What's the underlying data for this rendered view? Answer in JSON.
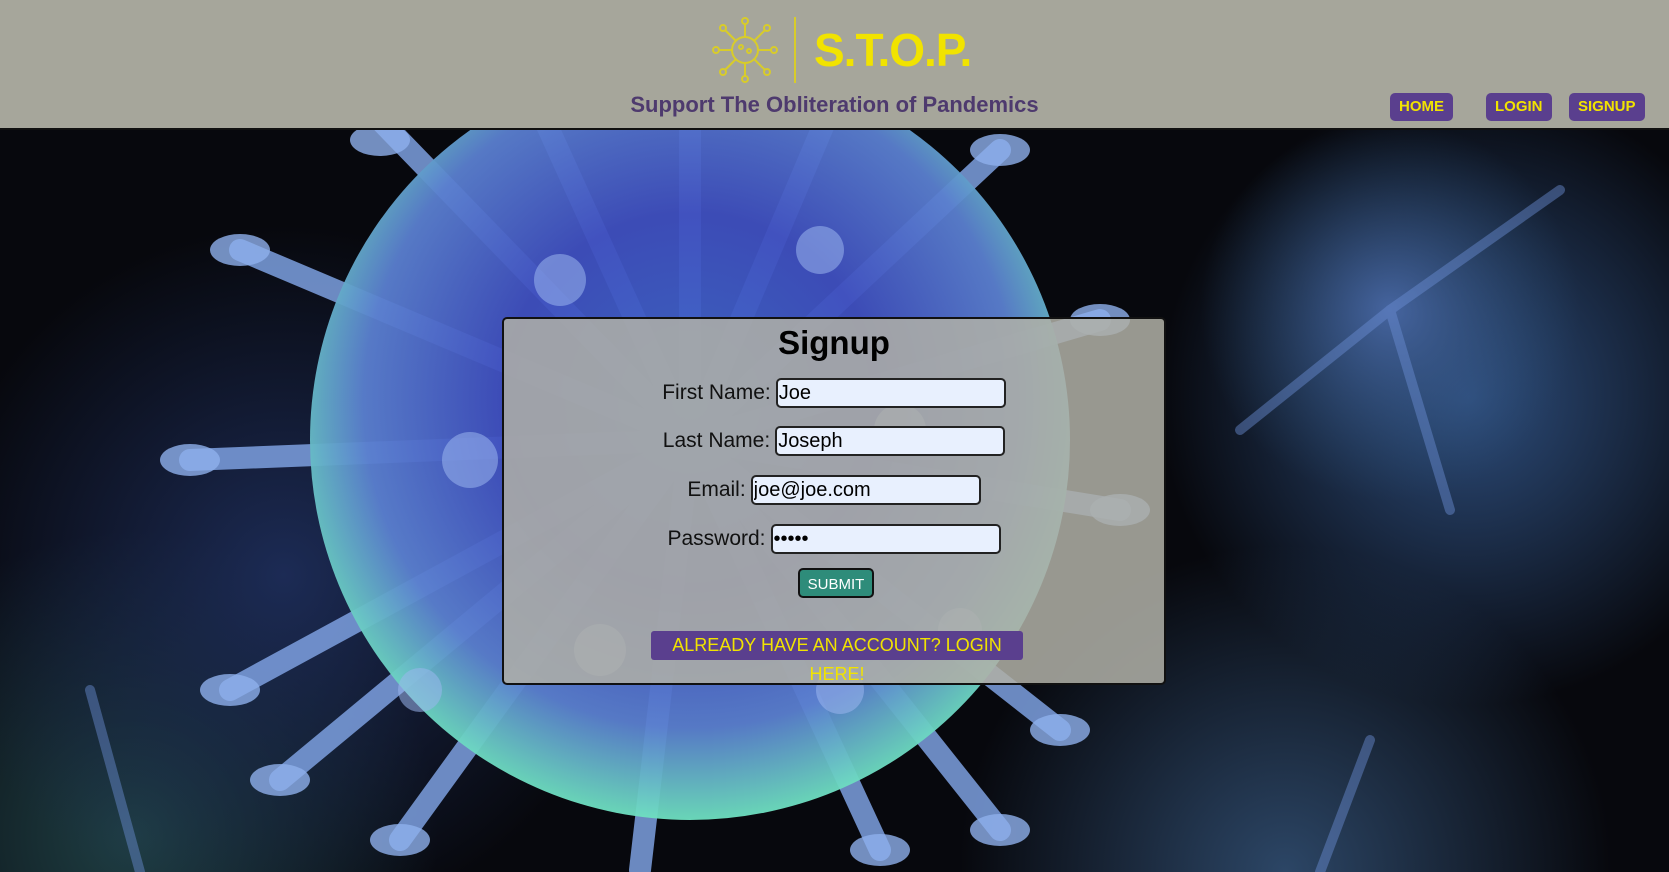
{
  "header": {
    "brand_name": "S.T.O.P.",
    "tagline": "Support The Obliteration of Pandemics",
    "logo_icon": "virus-icon",
    "nav": [
      {
        "label": "HOME"
      },
      {
        "label": "LOGIN"
      },
      {
        "label": "SIGNUP"
      }
    ]
  },
  "colors": {
    "header_bg": "#a6a69b",
    "brand_yellow": "#f1e300",
    "accent_purple": "#5a3f8e",
    "submit_green": "#2e8c7a"
  },
  "signup_form": {
    "title": "Signup",
    "fields": [
      {
        "label": "First Name:",
        "value": "Joe",
        "type": "text"
      },
      {
        "label": "Last Name:",
        "value": "Joseph",
        "type": "text"
      },
      {
        "label": "Email:",
        "value": "joe@joe.com",
        "type": "email"
      },
      {
        "label": "Password:",
        "value": "•••••",
        "type": "password"
      }
    ],
    "submit_label": "SUBMIT",
    "login_link_label": "ALREADY HAVE AN ACCOUNT? LOGIN HERE!"
  },
  "background": {
    "image_icon": "coronavirus-background-image"
  }
}
